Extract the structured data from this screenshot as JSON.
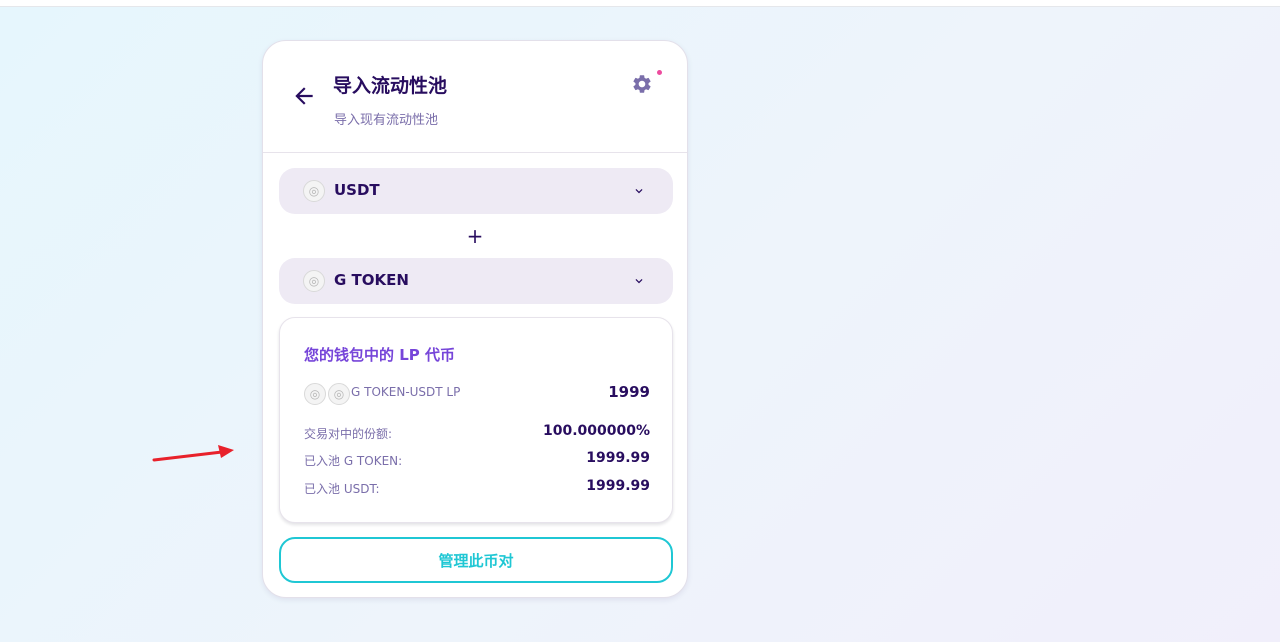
{
  "header": {
    "title": "导入流动性池",
    "subtitle": "导入现有流动性池"
  },
  "token_selectors": [
    {
      "symbol": "USDT"
    },
    {
      "symbol": "G TOKEN"
    }
  ],
  "plus": "+",
  "lp_position": {
    "title": "您的钱包中的 LP 代币",
    "pair_label": "G TOKEN-USDT LP",
    "pair_balance": "1999",
    "stats": [
      {
        "label": "交易对中的份额:",
        "value": "100.000000%"
      },
      {
        "label": "已入池 G TOKEN:",
        "value": "1999.99"
      },
      {
        "label": "已入池 USDT:",
        "value": "1999.99"
      }
    ]
  },
  "manage_button_label": "管理此币对",
  "icons": {
    "back": "arrow-left-icon",
    "settings": "gear-icon",
    "dropdown": "chevron-down-icon",
    "token_placeholder": "token-logo-icon"
  },
  "colors": {
    "primary_text": "#280d5f",
    "secondary_text": "#7a6eaa",
    "accent_purple": "#7645d9",
    "accent_cyan": "#1fc7d4",
    "notification_dot": "#ed4b9e",
    "input_bg": "#eeeaf4",
    "annotation_arrow": "#e8212b"
  }
}
